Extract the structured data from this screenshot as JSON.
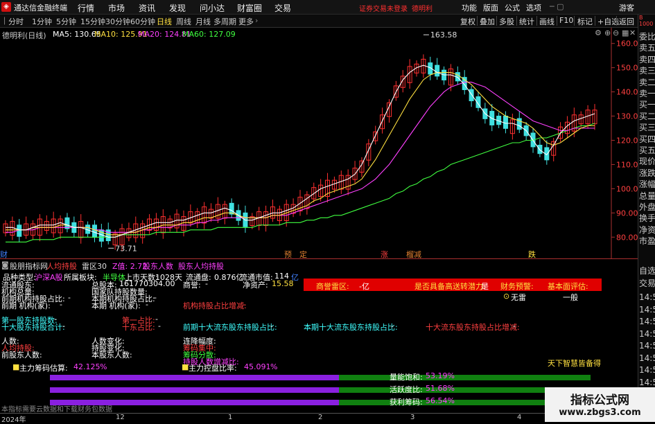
{
  "titlebar": {
    "app_title": "通达信金融终端",
    "menus": [
      "行情",
      "市场",
      "资讯",
      "发现",
      "问小达",
      "财富圈",
      "交易"
    ],
    "warning": "证券交易未登录",
    "stock_name_red": "德明利",
    "right_menus": [
      "功能",
      "版面",
      "公式",
      "选项"
    ],
    "guest": "游客"
  },
  "toolbar": {
    "periods": [
      "分时",
      "1分钟",
      "5分钟",
      "15分钟",
      "30分钟",
      "60分钟",
      "日线",
      "周线",
      "月线",
      "多周期",
      "更多"
    ],
    "active_period": "日线",
    "right_buttons": [
      "复权",
      "叠加",
      "多股",
      "统计",
      "画线",
      "F10",
      "标记",
      "+自选",
      "返回"
    ]
  },
  "side_panel": {
    "top_label": "B\n1000",
    "items": [
      "委比",
      "卖五",
      "卖四",
      "卖三",
      "卖二",
      "卖一",
      "买一",
      "买二",
      "买三",
      "买四",
      "买五",
      "现价",
      "涨跌",
      "涨幅",
      "总量",
      "外盘",
      "换手",
      "净资",
      "市盈"
    ],
    "bottom_items": [
      "自选",
      "交易"
    ],
    "time_items": [
      "14:5",
      "14:5",
      "14:5",
      "14:5",
      "14:5",
      "14:5",
      "14:5",
      "14:5",
      "14:5",
      "14:5"
    ]
  },
  "chart_title": "德明利(日线)",
  "ma_labels": [
    {
      "text": "MA5: 130.65",
      "color": "#ffffff"
    },
    {
      "text": "MA10: 125.91",
      "color": "#ffe040"
    },
    {
      "text": "MA20: 124.81",
      "color": "#ff40ff"
    },
    {
      "text": "MA60: 127.09",
      "color": "#40ff40"
    }
  ],
  "chart_data": {
    "type": "candlestick",
    "y_ticks": [
      "160.0",
      "150.0",
      "140.0",
      "130.0",
      "120.0",
      "110.0",
      "100.0",
      "90.00",
      "80.00"
    ],
    "ylim": [
      75.5,
      166.5
    ],
    "high_label": "163.58",
    "low_label": "73.71",
    "ma5_series": [
      84,
      84,
      83,
      83,
      84,
      85,
      85,
      85,
      86,
      85,
      84,
      84,
      83,
      82,
      81,
      80,
      80,
      81,
      82,
      83,
      84,
      85,
      86,
      86,
      86,
      87,
      87,
      88,
      89,
      90,
      90,
      91,
      92,
      91,
      89,
      87,
      87,
      88,
      89,
      90,
      90,
      91,
      92,
      94,
      96,
      98,
      100,
      101,
      102,
      103,
      104,
      106,
      110,
      116,
      122,
      128,
      134,
      140,
      145,
      148,
      150,
      151,
      150,
      148,
      147,
      147,
      146,
      143,
      139,
      135,
      131,
      129,
      128,
      127,
      127,
      126,
      124,
      120,
      116,
      114,
      118,
      123,
      126,
      128,
      129,
      130,
      131
    ],
    "ma10_series": [
      83,
      83,
      83,
      83,
      84,
      84,
      84,
      84,
      85,
      85,
      84,
      84,
      84,
      83,
      82,
      81,
      81,
      81,
      82,
      82,
      83,
      84,
      84,
      85,
      85,
      85,
      86,
      86,
      87,
      88,
      88,
      89,
      90,
      90,
      89,
      88,
      88,
      88,
      88,
      89,
      89,
      90,
      91,
      92,
      93,
      95,
      96,
      98,
      99,
      100,
      101,
      102,
      104,
      108,
      112,
      117,
      122,
      127,
      132,
      137,
      141,
      145,
      147,
      148,
      148,
      148,
      147,
      145,
      143,
      140,
      137,
      134,
      132,
      130,
      129,
      128,
      127,
      125,
      122,
      119,
      118,
      119,
      121,
      123,
      125,
      126,
      126
    ],
    "ma20_series": [
      82,
      82,
      83,
      83,
      83,
      84,
      84,
      84,
      84,
      84,
      84,
      84,
      84,
      83,
      83,
      82,
      82,
      82,
      82,
      82,
      83,
      83,
      84,
      84,
      84,
      85,
      85,
      85,
      86,
      86,
      87,
      87,
      88,
      88,
      88,
      88,
      88,
      88,
      88,
      89,
      89,
      89,
      90,
      91,
      92,
      93,
      94,
      95,
      96,
      97,
      98,
      99,
      100,
      102,
      104,
      107,
      110,
      114,
      118,
      122,
      126,
      130,
      134,
      137,
      140,
      142,
      143,
      144,
      144,
      143,
      142,
      140,
      138,
      136,
      134,
      132,
      130,
      128,
      127,
      126,
      125,
      124,
      124,
      125,
      125,
      125,
      125
    ],
    "ma60_series": [
      78,
      78,
      78,
      78,
      79,
      79,
      79,
      79,
      80,
      80,
      80,
      80,
      80,
      80,
      80,
      80,
      80,
      81,
      81,
      81,
      81,
      81,
      82,
      82,
      82,
      82,
      82,
      83,
      83,
      83,
      83,
      84,
      84,
      84,
      84,
      84,
      84,
      85,
      85,
      85,
      85,
      86,
      86,
      86,
      87,
      87,
      88,
      88,
      89,
      89,
      90,
      91,
      92,
      93,
      94,
      95,
      96,
      98,
      99,
      101,
      102,
      104,
      105,
      107,
      108,
      110,
      111,
      112,
      113,
      114,
      115,
      116,
      117,
      118,
      119,
      119,
      120,
      120,
      121,
      121,
      122,
      123,
      124,
      125,
      126,
      126,
      127
    ]
  },
  "signals": {
    "yu": "预",
    "ding": "定",
    "zhang": "涨",
    "liuying": "榴减",
    "die": "跌"
  },
  "indicator": {
    "name": "股朋指标网",
    "sub1": "人均持股",
    "sub2": "雷区30",
    "z_label": "Z值: 2.72",
    "hold_num": "股东人数",
    "hold_avg": "股东人均持股",
    "rows": {
      "pinzhong": "品种类型:",
      "pinzhong_val": "沪深A股",
      "bankuai": "所属板块:",
      "bankuai_val": "半导体",
      "ssts": "上市天数:",
      "ssts_val": "1028天",
      "ltp": "流通盘:",
      "ltp_val": "0.876亿",
      "ltsz": "流通市值:",
      "ltsz_val": "114",
      "ltsz_unit": "亿",
      "ltgd": "流通股东:",
      "zgb": "总股本:",
      "zgb_val": "161770304.00",
      "shangyu": "商誉:",
      "shangyu_val": "-",
      "jzc": "净资产:",
      "jzc_val": "15.58",
      "jg_sum": "机构总量:",
      "gjdz": "国家队持股数量:",
      "qq_jg": "前期机构持股占比:",
      "bq_jg": "本期机构持股占比:",
      "qq_jgj": "前期 机构(家):",
      "bq_jgj": "本期 机构(家):",
      "jg_inc": "机构持股占比增减:",
      "d1gd": "第一股东持股数:",
      "sdlt": "十大股东持股合计:",
      "d1zb": "第一占比:",
      "sdzb": "十东占比:",
      "qqsd": "前期十大流东股东持股占比:",
      "bqsd": "本期十大流东股东持股占比:",
      "sdinc": "十大流东股东持股占比增减:",
      "rs": "人数:",
      "rjcg": "人均持股:",
      "qgdrs": "前股东人数:",
      "rsbh": "人数变化:",
      "cgbh": "持股变化:",
      "bgdrs": "本股东人数:",
      "ljfd": "连降幅度:",
      "jzsz": "筹码集中:",
      "fs": "筹码分散:",
      "rszj": "持股人数增减比:",
      "dash": "-"
    },
    "panel": {
      "sld": "商誉雷区:",
      "sld_val": "-亿",
      "gsz": "是否具备高送转潜力:",
      "gsz_val": "是",
      "cwyj": "财务预警:",
      "cwyj_val": "无雷",
      "jbmpg": "基本面评估:",
      "jbmpg_val": "一般"
    },
    "zl_cm": "主力筹码估算:",
    "zl_cm_val": "42.125",
    "zl_kp": "主力控盘比率:",
    "zl_kp_val": "45.091",
    "pct": "%",
    "tagline": "天下智慧皆备得",
    "bars": [
      {
        "label": "量能饱和:",
        "value": "53.19%",
        "fraction": 0.5319
      },
      {
        "label": "活跃度比:",
        "value": "51.68%",
        "fraction": 0.5168
      },
      {
        "label": "获利筹码:",
        "value": "56.54%",
        "fraction": 0.5654
      }
    ],
    "footer_note": "本指标需要云数据和下载财务包数据"
  },
  "date_axis": [
    "2024年",
    "12",
    "1",
    "2",
    "3",
    "4"
  ],
  "watermark": {
    "line1": "指标公式网",
    "line2": "www.zbgs3.com"
  }
}
